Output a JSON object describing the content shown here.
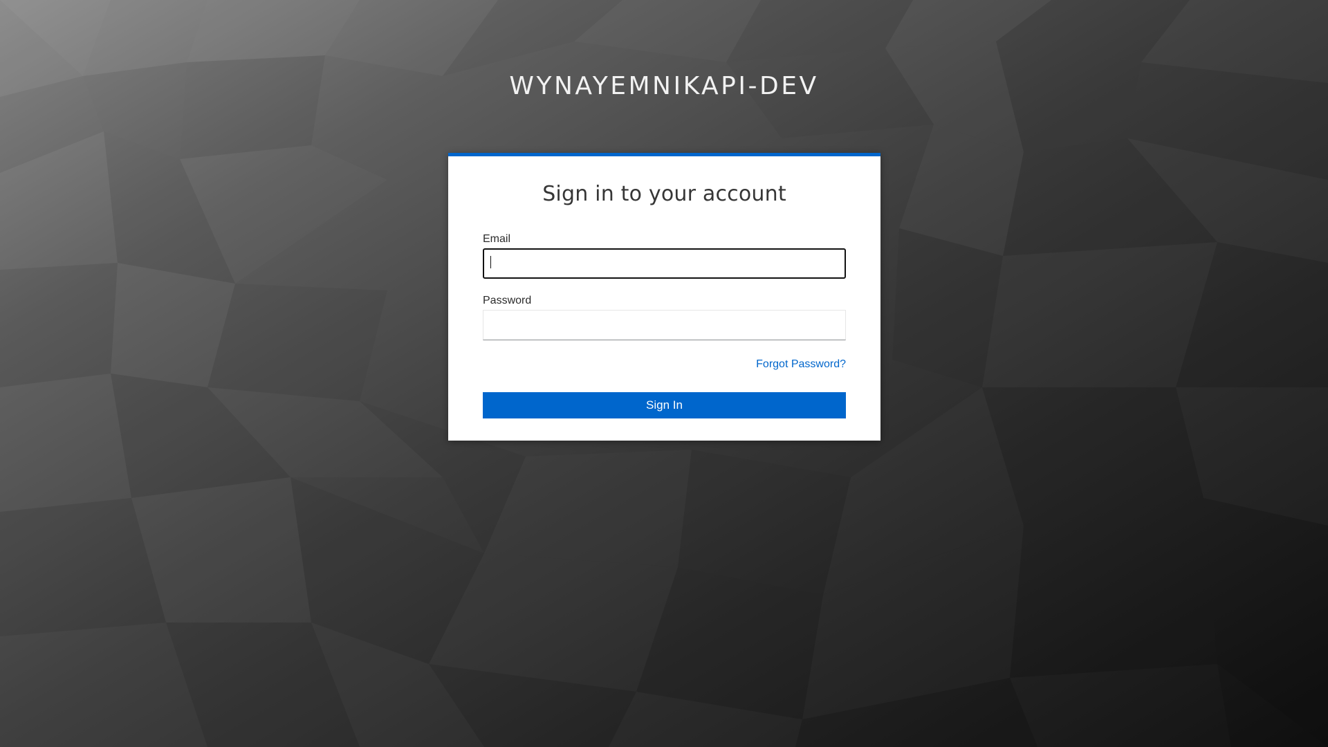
{
  "realm": {
    "title": "WYNAYEMNIKAPI-DEV"
  },
  "login": {
    "heading": "Sign in to your account",
    "email_label": "Email",
    "email_value": "",
    "password_label": "Password",
    "password_value": "",
    "forgot_password": "Forgot Password?",
    "sign_in_label": "Sign In"
  },
  "colors": {
    "accent": "#0066cc",
    "card_background": "#ffffff",
    "title_text": "#f2f2f2"
  }
}
